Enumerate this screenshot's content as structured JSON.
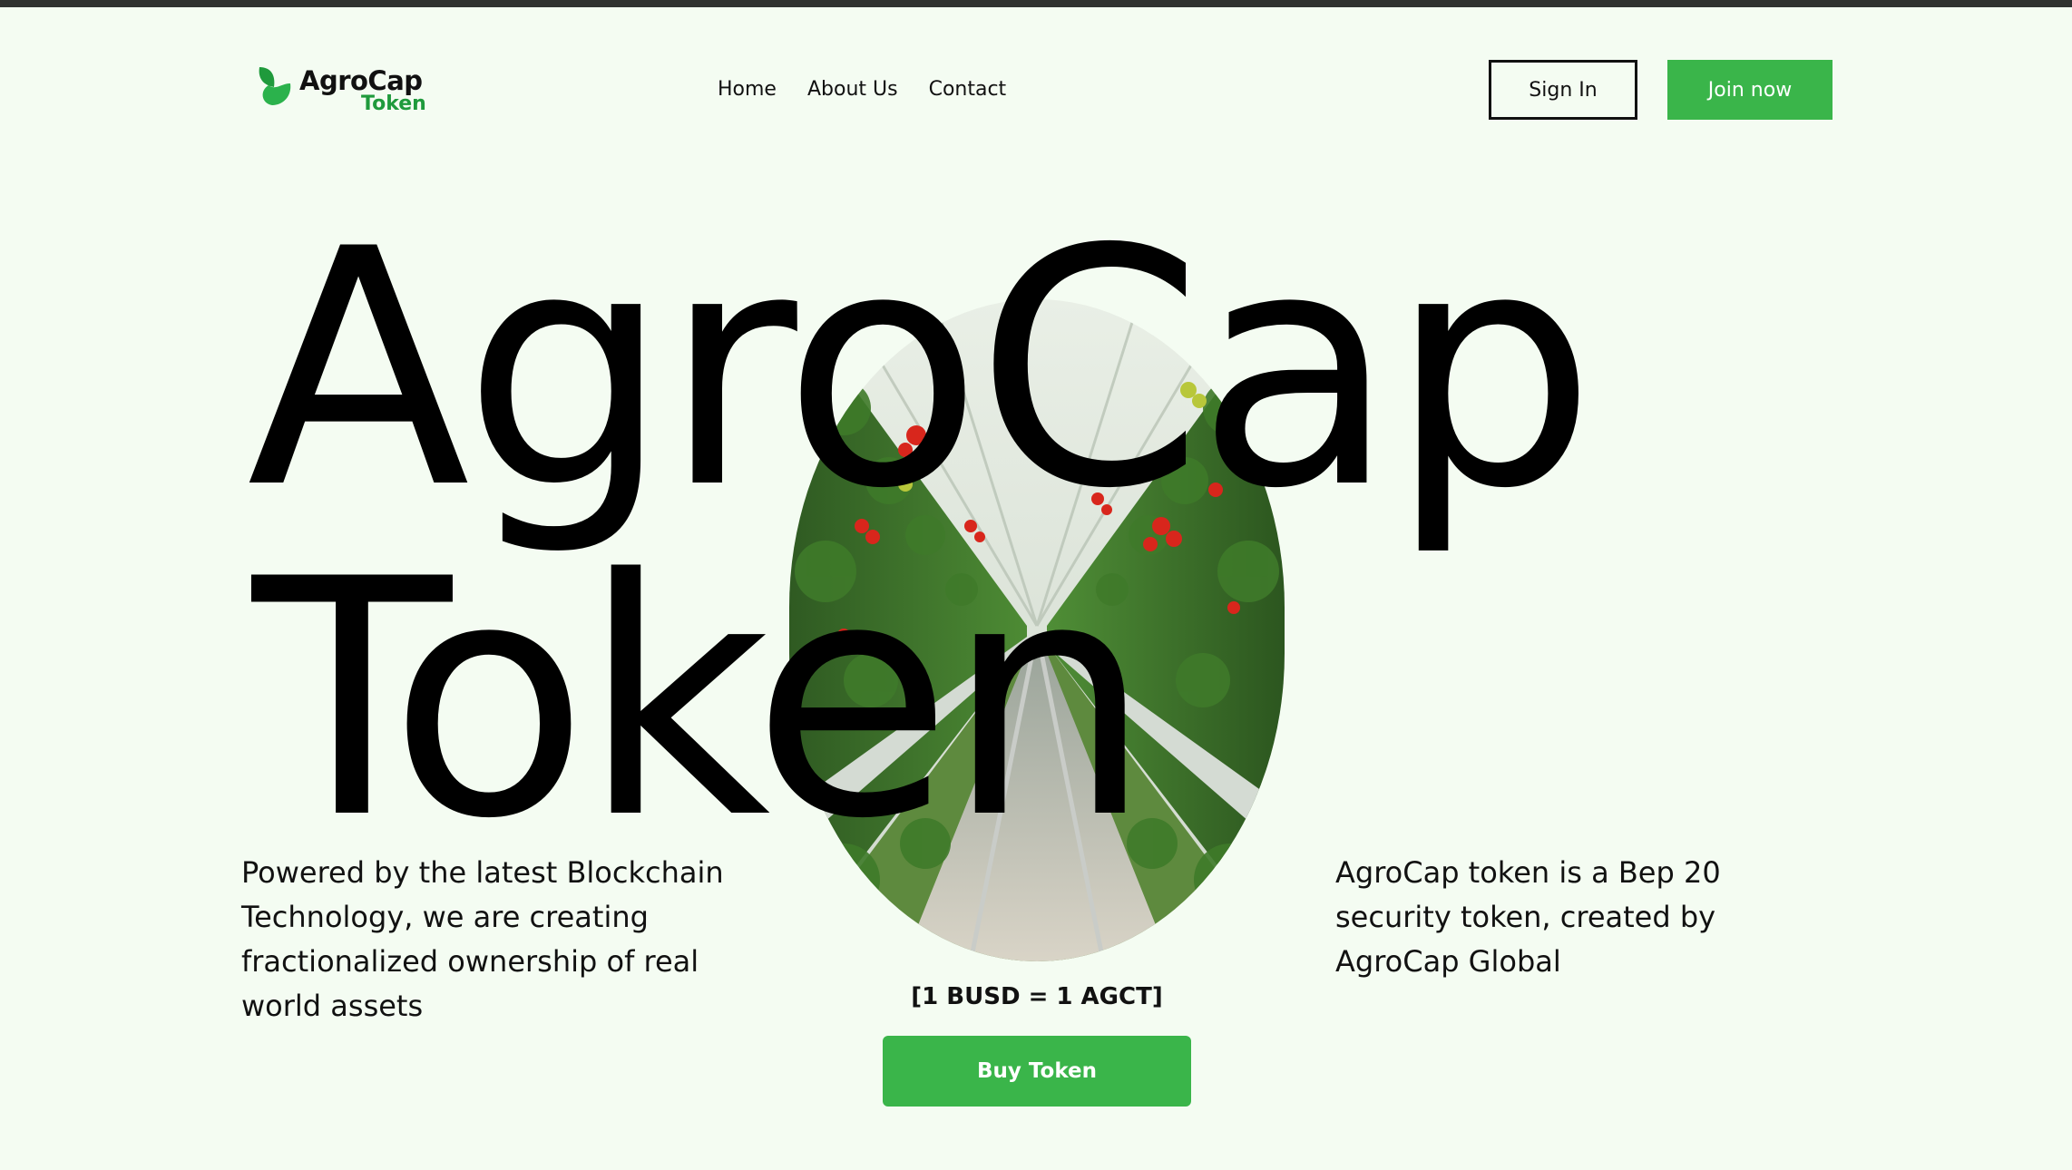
{
  "brand": {
    "name": "AgroCap",
    "sub": "Token",
    "green": "#3ab54a",
    "dark_green": "#1f9a3c",
    "background": "#f4fcf2"
  },
  "nav": {
    "items": [
      {
        "label": "Home"
      },
      {
        "label": "About Us"
      },
      {
        "label": "Contact"
      }
    ]
  },
  "header": {
    "signin_label": "Sign In",
    "join_label": "Join now"
  },
  "hero": {
    "title_line1": "AgroCap",
    "title_line2": "Token",
    "image_icon": "greenhouse-tomato-rows-image",
    "left_text": "Powered by the latest Blockchain Technology, we are creating fractionalized ownership of real world assets",
    "right_text": "AgroCap token is a Bep 20 security token, created by AgroCap Global",
    "rate": "[1 BUSD = 1 AGCT]",
    "buy_label": "Buy Token"
  }
}
